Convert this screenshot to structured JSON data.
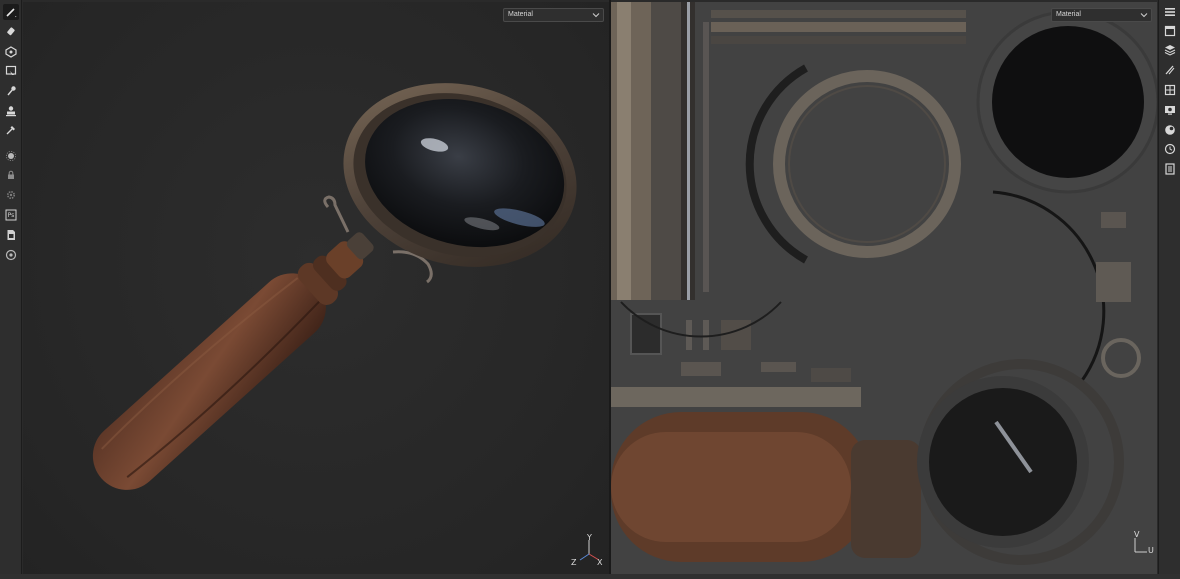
{
  "viewport3d": {
    "channel_select": {
      "value": "Material"
    },
    "gizmo": {
      "y": "Y",
      "z": "Z",
      "x": "X"
    }
  },
  "viewport2d": {
    "channel_select": {
      "value": "Material"
    },
    "gizmo": {
      "v": "V",
      "u": "U"
    }
  },
  "toolbar_left": {
    "tools": [
      "paint-brush-icon",
      "eraser-icon",
      "projection-icon",
      "polygon-fill-icon",
      "smudge-icon",
      "clone-icon",
      "color-picker-icon",
      "bake-icon",
      "lock-icon",
      "settings-icon",
      "photoshop-export-icon",
      "export-icon",
      "plugin-icon"
    ],
    "ps_label": "Ps"
  },
  "toolbar_right": {
    "tools": [
      "texture-set-list-icon",
      "texture-set-settings-icon",
      "layers-icon",
      "brush-settings-icon",
      "display-settings-icon",
      "viewer-settings-icon",
      "shader-settings-icon",
      "history-icon",
      "log-icon"
    ]
  }
}
